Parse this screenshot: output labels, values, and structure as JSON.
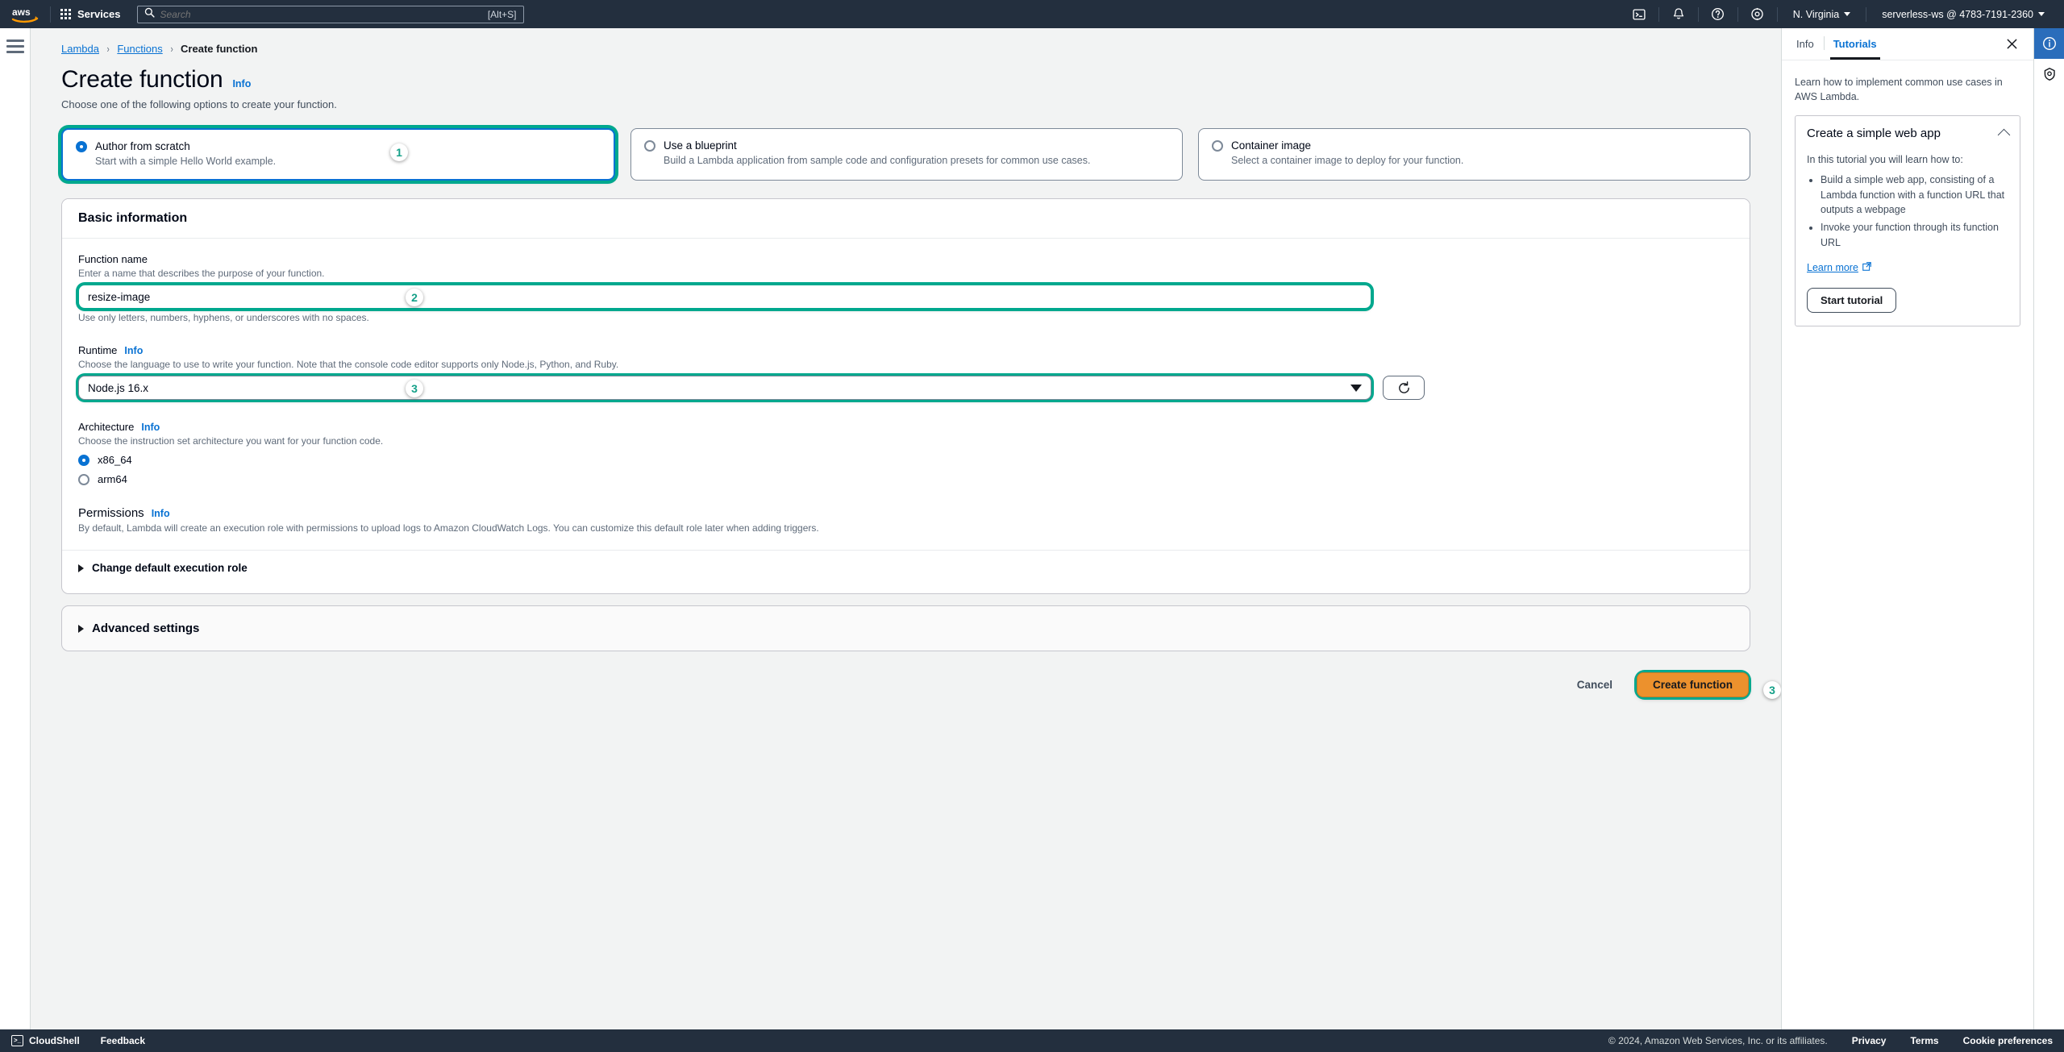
{
  "topnav": {
    "logo_alt": "aws",
    "services_label": "Services",
    "search_placeholder": "Search",
    "search_value": "",
    "search_shortcut": "[Alt+S]",
    "cloudshell_icon": "cloudshell-icon",
    "notifications_icon": "bell-icon",
    "help_icon": "question-circle-icon",
    "settings_icon": "gear-icon",
    "region_label": "N. Virginia",
    "account_label": "serverless-ws @ 4783-7191-2360"
  },
  "breadcrumb": {
    "items": [
      {
        "label": "Lambda",
        "current": false
      },
      {
        "label": "Functions",
        "current": false
      },
      {
        "label": "Create function",
        "current": true
      }
    ],
    "separator": "›"
  },
  "page": {
    "title": "Create function",
    "info_label": "Info",
    "subtitle": "Choose one of the following options to create your function."
  },
  "options": [
    {
      "title": "Author from scratch",
      "description": "Start with a simple Hello World example.",
      "selected": true,
      "badge": "1"
    },
    {
      "title": "Use a blueprint",
      "description": "Build a Lambda application from sample code and configuration presets for common use cases.",
      "selected": false,
      "badge": null
    },
    {
      "title": "Container image",
      "description": "Select a container image to deploy for your function.",
      "selected": false,
      "badge": null
    }
  ],
  "basic_information": {
    "heading": "Basic information",
    "function_name": {
      "label": "Function name",
      "description": "Enter a name that describes the purpose of your function.",
      "value": "resize-image",
      "placeholder": "",
      "hint": "Use only letters, numbers, hyphens, or underscores with no spaces.",
      "badge": "2"
    },
    "runtime": {
      "label": "Runtime",
      "info_label": "Info",
      "description": "Choose the language to use to write your function. Note that the console code editor supports only Node.js, Python, and Ruby.",
      "selected": "Node.js 16.x",
      "badge": "3",
      "refresh_icon": "refresh-icon"
    },
    "architecture": {
      "label": "Architecture",
      "info_label": "Info",
      "description": "Choose the instruction set architecture you want for your function code.",
      "options": [
        {
          "label": "x86_64",
          "selected": true
        },
        {
          "label": "arm64",
          "selected": false
        }
      ]
    },
    "permissions": {
      "label": "Permissions",
      "info_label": "Info",
      "description": "By default, Lambda will create an execution role with permissions to upload logs to Amazon CloudWatch Logs. You can customize this default role later when adding triggers.",
      "expander_label": "Change default execution role"
    }
  },
  "advanced_settings": {
    "label": "Advanced settings"
  },
  "actions": {
    "cancel_label": "Cancel",
    "create_label": "Create function",
    "create_badge": "3"
  },
  "right_panel": {
    "tabs": [
      {
        "label": "Info",
        "active": false
      },
      {
        "label": "Tutorials",
        "active": true
      }
    ],
    "close_icon": "close-icon",
    "intro": "Learn how to implement common use cases in AWS Lambda.",
    "tutorial": {
      "title": "Create a simple web app",
      "collapse_icon": "chevron-up-icon",
      "intro": "In this tutorial you will learn how to:",
      "bullets": [
        "Build a simple web app, consisting of a Lambda function with a function URL that outputs a webpage",
        "Invoke your function through its function URL"
      ],
      "learn_more_label": "Learn more",
      "external_icon": "external-link-icon",
      "start_label": "Start tutorial"
    }
  },
  "icon_rail": [
    {
      "name": "info-circle-icon",
      "active": true
    },
    {
      "name": "shield-icon",
      "active": false
    }
  ],
  "footer": {
    "cloudshell_label": "CloudShell",
    "feedback_label": "Feedback",
    "copyright": "© 2024, Amazon Web Services, Inc. or its affiliates.",
    "links": [
      "Privacy",
      "Terms",
      "Cookie preferences"
    ]
  },
  "colors": {
    "nav_bg": "#232f3e",
    "accent_blue": "#0972d3",
    "highlight_green": "#00a88e",
    "primary_orange": "#ec912d",
    "page_bg": "#f2f3f3"
  }
}
